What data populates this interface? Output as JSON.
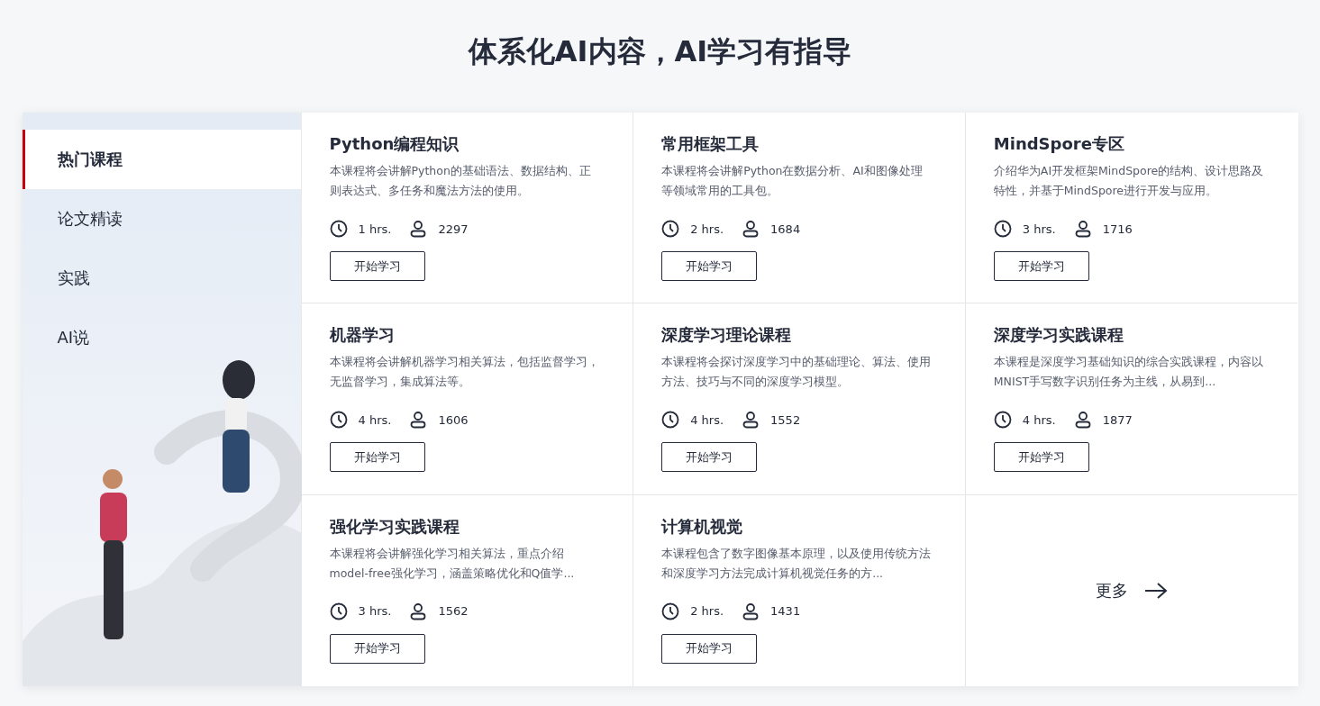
{
  "heading": "体系化AI内容，AI学习有指导",
  "tabs": [
    {
      "label": "热门课程",
      "selected": true
    },
    {
      "label": "论文精读",
      "selected": false
    },
    {
      "label": "实践",
      "selected": false
    },
    {
      "label": "AI说",
      "selected": false
    }
  ],
  "courses": [
    {
      "title": "Python编程知识",
      "description": "本课程将会讲解Python的基础语法、数据结构、正则表达式、多任务和魔法方法的使用。",
      "duration": "1 hrs.",
      "learners": "2297",
      "button": "开始学习"
    },
    {
      "title": "常用框架工具",
      "description": "本课程将会讲解Python在数据分析、AI和图像处理等领域常用的工具包。",
      "duration": "2 hrs.",
      "learners": "1684",
      "button": "开始学习"
    },
    {
      "title": "MindSpore专区",
      "description": "介绍华为AI开发框架MindSpore的结构、设计思路及特性，并基于MindSpore进行开发与应用。",
      "duration": "3 hrs.",
      "learners": "1716",
      "button": "开始学习"
    },
    {
      "title": "机器学习",
      "description": "本课程将会讲解机器学习相关算法，包括监督学习，无监督学习，集成算法等。",
      "duration": "4 hrs.",
      "learners": "1606",
      "button": "开始学习"
    },
    {
      "title": "深度学习理论课程",
      "description": "本课程将会探讨深度学习中的基础理论、算法、使用方法、技巧与不同的深度学习模型。",
      "duration": "4 hrs.",
      "learners": "1552",
      "button": "开始学习"
    },
    {
      "title": "深度学习实践课程",
      "description": "本课程是深度学习基础知识的综合实践课程，内容以MNIST手写数字识别任务为主线，从易到...",
      "duration": "4 hrs.",
      "learners": "1877",
      "button": "开始学习"
    },
    {
      "title": "强化学习实践课程",
      "description": "本课程将会讲解强化学习相关算法，重点介绍model-free强化学习，涵盖策略优化和Q值学...",
      "duration": "3 hrs.",
      "learners": "1562",
      "button": "开始学习"
    },
    {
      "title": "计算机视觉",
      "description": "本课程包含了数字图像基本原理，以及使用传统方法和深度学习方法完成计算机视觉任务的方...",
      "duration": "2 hrs.",
      "learners": "1431",
      "button": "开始学习"
    }
  ],
  "more_link": "更多"
}
